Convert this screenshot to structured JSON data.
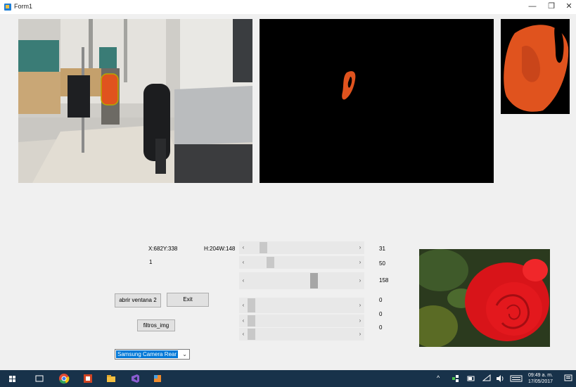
{
  "window": {
    "title": "Form1",
    "minimize_glyph": "—",
    "restore_glyph": "❐",
    "close_glyph": "✕"
  },
  "images": {
    "camera": "camera-feed-image",
    "mask": "segmentation-mask-image",
    "crop": "object-crop-image",
    "reference": "rose-image"
  },
  "labels": {
    "coords": "X:682Y:338",
    "size": "H:204W:148",
    "count": "1"
  },
  "sliders": [
    {
      "value": "31",
      "fraction": 0.12
    },
    {
      "value": "50",
      "fraction": 0.19
    },
    {
      "value": "158",
      "fraction": 0.62
    },
    {
      "value": "0",
      "fraction": 0.0
    },
    {
      "value": "0",
      "fraction": 0.0
    },
    {
      "value": "0",
      "fraction": 0.0
    }
  ],
  "scroll": {
    "left_glyph": "‹",
    "right_glyph": "›"
  },
  "buttons": {
    "open_window": "abrir ventana 2",
    "exit": "Exit",
    "filters": "filtros_img"
  },
  "camera_select": {
    "selected": "Samsung Camera Rear",
    "chevron": "⌄"
  },
  "taskbar": {
    "items": [
      "start-icon",
      "task-view-icon",
      "chrome-icon",
      "powerpoint-icon",
      "file-explorer-icon",
      "visual-studio-icon",
      "form-app-icon"
    ],
    "tray_chevron": "^",
    "time": "09:49 a. m.",
    "date": "17/05/2017"
  },
  "colors": {
    "titlebar": "#ffffff",
    "form_bg": "#f0f0f0",
    "taskbar": "#18324a",
    "select_highlight": "#0078d7",
    "object_orange": "#e0531e",
    "rose_red": "#e3181d"
  }
}
